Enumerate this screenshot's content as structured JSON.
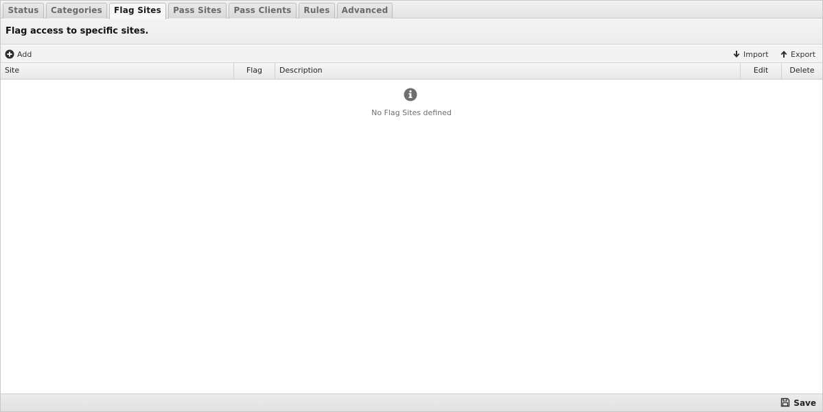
{
  "tabs": [
    {
      "label": "Status",
      "active": false
    },
    {
      "label": "Categories",
      "active": false
    },
    {
      "label": "Flag Sites",
      "active": true
    },
    {
      "label": "Pass Sites",
      "active": false
    },
    {
      "label": "Pass Clients",
      "active": false
    },
    {
      "label": "Rules",
      "active": false
    },
    {
      "label": "Advanced",
      "active": false
    }
  ],
  "heading": "Flag access to specific sites.",
  "toolbar": {
    "add_label": "Add",
    "add_icon": "plus-circle-icon",
    "import_label": "Import",
    "import_icon": "arrow-down-icon",
    "export_label": "Export",
    "export_icon": "arrow-up-icon"
  },
  "grid": {
    "columns": [
      "Site",
      "Flag",
      "Description",
      "Edit",
      "Delete"
    ],
    "rows": [],
    "empty_icon": "info-circle-icon",
    "empty_text": "No Flag Sites defined"
  },
  "footer": {
    "save_label": "Save",
    "save_icon": "floppy-disk-icon"
  },
  "colors": {
    "icon_gray": "#6f6f6f",
    "active_tab_text": "#1a1a1a",
    "inactive_tab_text": "#6a6a6a"
  }
}
